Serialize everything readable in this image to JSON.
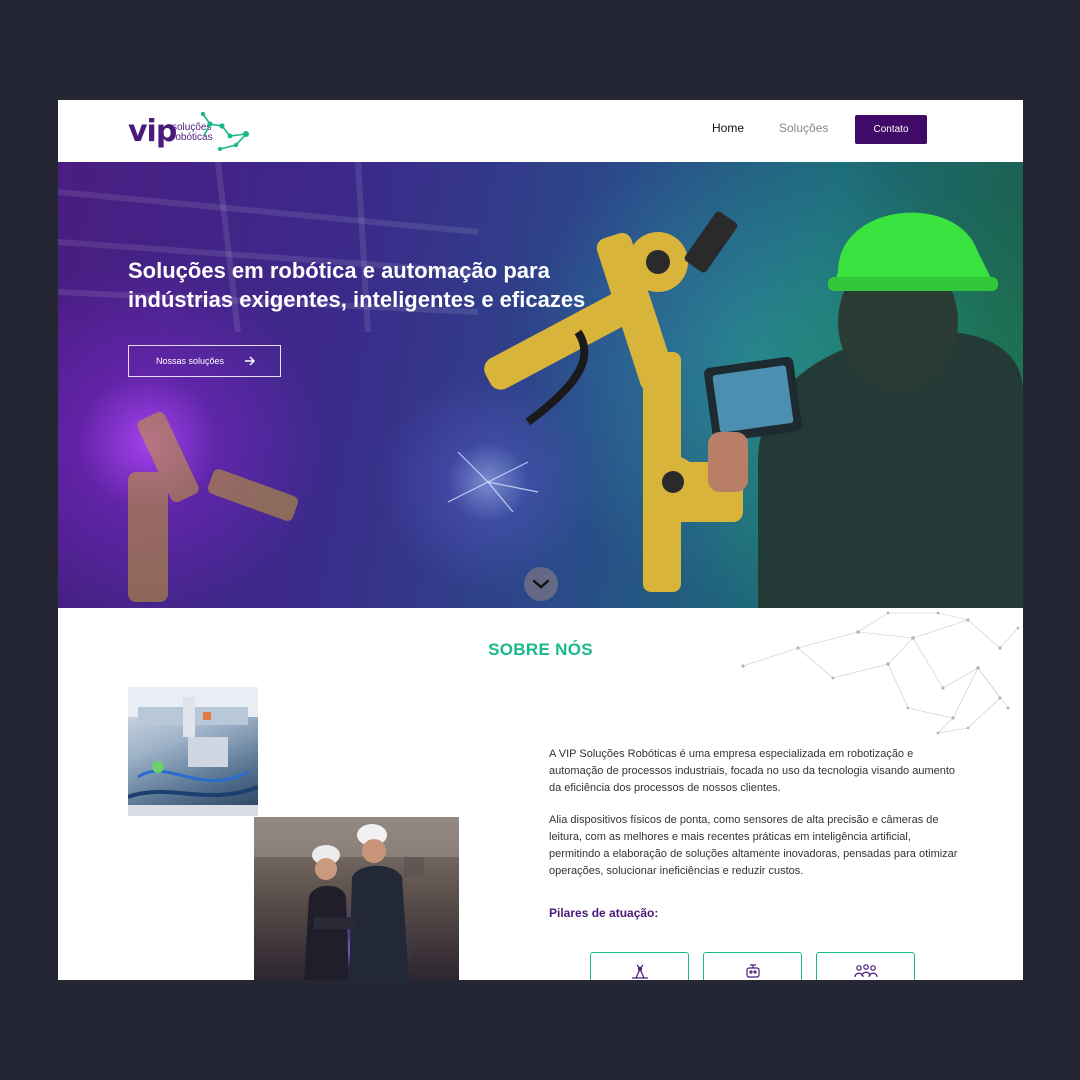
{
  "header": {
    "logo": {
      "brand": "vip",
      "line1": "soluções",
      "line2": "robóticas"
    },
    "nav": {
      "home": "Home",
      "solutions": "Soluções",
      "contact": "Contato"
    }
  },
  "hero": {
    "title": "Soluções em robótica e automação para indústrias exigentes, inteligentes e eficazes",
    "cta": "Nossas soluções"
  },
  "about": {
    "title": "SOBRE NÓS",
    "paragraph1": "A VIP Soluções Robóticas é uma empresa especializada em robotização e automação de processos industriais, focada no uso da tecnologia visando aumento da eficiência dos processos de nossos clientes.",
    "paragraph2": "Alia dispositivos físicos de ponta, como sensores de alta precisão e câmeras de leitura, com as melhores e mais recentes práticas em inteligência artificial, permitindo a elaboração de soluções altamente inovadoras, pensadas para otimizar operações, solucionar ineficiências e reduzir custos.",
    "pillars_title": "Pilares de atuação:",
    "pillars": [
      {
        "icon": "robot-arm-icon"
      },
      {
        "icon": "robot-gear-icon"
      },
      {
        "icon": "network-people-icon"
      }
    ]
  },
  "colors": {
    "background": "#242733",
    "brand_purple": "#3f0a68",
    "accent_green": "#19b88a",
    "logo_purple": "#4a1a7a"
  }
}
